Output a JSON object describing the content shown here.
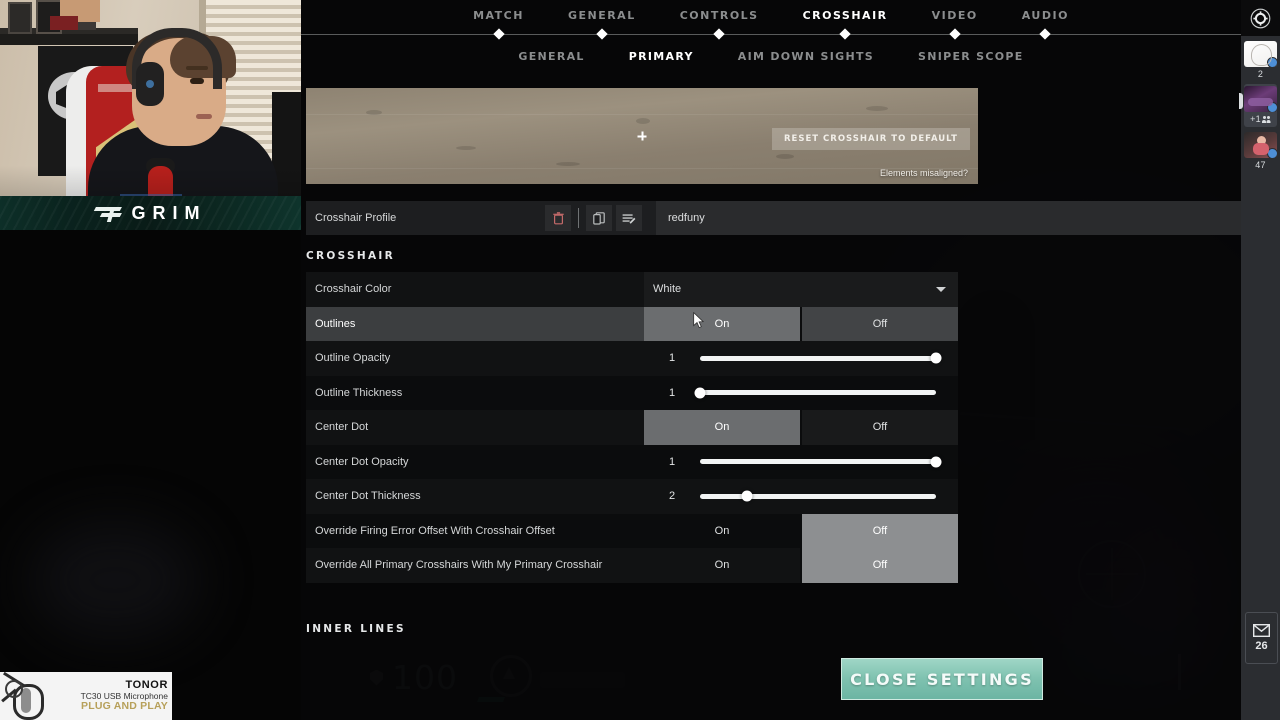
{
  "stream": {
    "webcam": {
      "streamer_name": "GRIM",
      "logo_icon": "t1-logo-icon"
    },
    "sponsor_ad": {
      "brand": "TONOR",
      "model": "TC30 USB Microphone",
      "tagline": "PLUG AND PLAY",
      "icon": "microphone-icon"
    },
    "hud": {
      "health": "100",
      "shield_icon": "shield-icon"
    }
  },
  "settings": {
    "top_tabs": [
      {
        "label": "MATCH",
        "active": false
      },
      {
        "label": "GENERAL",
        "active": false
      },
      {
        "label": "CONTROLS",
        "active": false
      },
      {
        "label": "CROSSHAIR",
        "active": true
      },
      {
        "label": "VIDEO",
        "active": false
      },
      {
        "label": "AUDIO",
        "active": false
      }
    ],
    "sub_tabs": [
      {
        "label": "GENERAL",
        "active": false
      },
      {
        "label": "PRIMARY",
        "active": true
      },
      {
        "label": "AIM DOWN SIGHTS",
        "active": false
      },
      {
        "label": "SNIPER SCOPE",
        "active": false
      }
    ],
    "preview": {
      "reset_label": "RESET CROSSHAIR TO DEFAULT",
      "misaligned_label": "Elements misaligned?"
    },
    "profile": {
      "label": "Crosshair Profile",
      "value": "redfuny",
      "delete_icon": "trash-icon",
      "duplicate_icon": "copy-icon",
      "rename_icon": "edit-icon",
      "caret_icon": "chevron-down-icon"
    },
    "sections": {
      "crosshair_title": "CROSSHAIR",
      "inner_lines_title": "INNER LINES"
    },
    "rows": [
      {
        "label": "Crosshair Color",
        "type": "select",
        "value": "White",
        "hovered": false
      },
      {
        "label": "Outlines",
        "type": "toggle",
        "on_label": "On",
        "off_label": "Off",
        "value": "On",
        "hovered": true
      },
      {
        "label": "Outline Opacity",
        "type": "slider",
        "value": "1",
        "percent": 100,
        "hovered": false
      },
      {
        "label": "Outline Thickness",
        "type": "slider",
        "value": "1",
        "percent": 0,
        "hovered": false
      },
      {
        "label": "Center Dot",
        "type": "toggle",
        "on_label": "On",
        "off_label": "Off",
        "value": "On",
        "hovered": false
      },
      {
        "label": "Center Dot Opacity",
        "type": "slider",
        "value": "1",
        "percent": 100,
        "hovered": false
      },
      {
        "label": "Center Dot Thickness",
        "type": "slider",
        "value": "2",
        "percent": 20,
        "hovered": false
      },
      {
        "label": "Override Firing Error Offset With Crosshair Offset",
        "type": "toggle",
        "on_label": "On",
        "off_label": "Off",
        "value": "Off",
        "hovered": false
      },
      {
        "label": "Override All Primary Crosshairs With My Primary Crosshair",
        "type": "toggle",
        "on_label": "On",
        "off_label": "Off",
        "value": "Off",
        "hovered": false
      }
    ],
    "close_label": "CLOSE SETTINGS",
    "gear_icon": "gear-icon"
  },
  "rail": {
    "items": [
      {
        "caption": "2",
        "icon": "server-avatar-icon",
        "has_badge": true,
        "selected": false,
        "group_icon": false
      },
      {
        "caption": "+1",
        "icon": "server-avatar-icon",
        "has_badge": true,
        "selected": true,
        "group_icon": true
      },
      {
        "caption": "47",
        "icon": "server-avatar-icon",
        "has_badge": true,
        "selected": false,
        "group_icon": false
      }
    ],
    "mail": {
      "count": "26",
      "icon": "envelope-icon"
    }
  },
  "colors": {
    "accent_close": "#7fc2b0",
    "toggle_selected": "#8d8f91",
    "hover_row": "#3c3e40",
    "nameplate": "#0d2f28"
  }
}
